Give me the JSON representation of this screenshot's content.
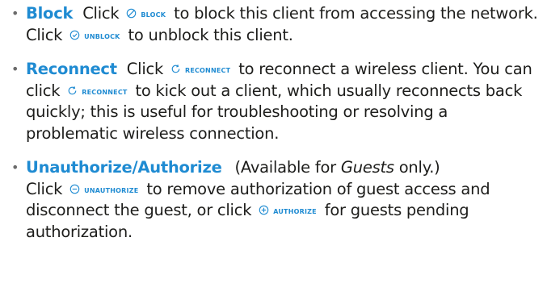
{
  "accent_color": "#1f8bd2",
  "items": [
    {
      "term": "Block",
      "text_1": "Click",
      "icon_1": {
        "name": "block-icon",
        "label": "BLOCK"
      },
      "text_2": "to block this client from accessing the network. Click",
      "icon_2": {
        "name": "unblock-icon",
        "label": "UNBLOCK"
      },
      "text_3": "to unblock this client."
    },
    {
      "term": "Reconnect",
      "text_1": "Click",
      "icon_1": {
        "name": "reconnect-icon",
        "label": "RECONNECT"
      },
      "text_2": "to reconnect a wireless client. You can click",
      "icon_2": {
        "name": "reconnect-icon",
        "label": "RECONNECT"
      },
      "text_3": "to kick out a client, which usually reconnects back quickly; this is useful for troubleshooting or resolving a problematic wireless connection."
    },
    {
      "term": "Unauthorize/Authorize",
      "note_open": "(Available for",
      "note_em": "Guests",
      "note_close": "only.)",
      "text_1": "Click",
      "icon_1": {
        "name": "unauthorize-icon",
        "label": "UNAUTHORIZE"
      },
      "text_2": "to remove authorization of guest access and disconnect the guest, or click",
      "icon_2": {
        "name": "authorize-icon",
        "label": "AUTHORIZE"
      },
      "text_3": "for guests pending authorization."
    }
  ]
}
